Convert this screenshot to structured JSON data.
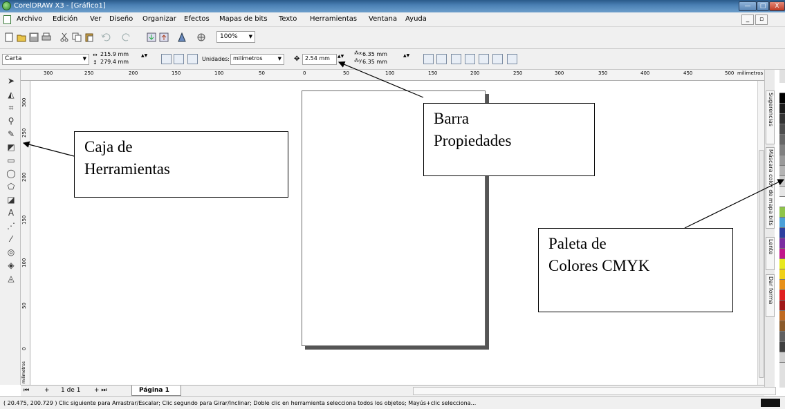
{
  "window": {
    "title": "CorelDRAW X3 - [Gráfico1]",
    "min_label": "—",
    "max_label": "□",
    "close_label": "X"
  },
  "menu": {
    "items": [
      "Archivo",
      "Edición",
      "Ver",
      "Diseño",
      "Organizar",
      "Efectos",
      "Mapas de bits",
      "Texto",
      "Herramientas",
      "Ventana",
      "Ayuda"
    ],
    "mdi_min": "_",
    "mdi_restore": "▫"
  },
  "toolbar": {
    "zoom": "100%"
  },
  "propbar": {
    "paper_size": "Carta",
    "width": "215.9 mm",
    "height": "279.4 mm",
    "units_label": "Unidades:",
    "units_value": "milímetros",
    "nudge": "2.54 mm",
    "dup_x": "6.35 mm",
    "dup_y": "6.35 mm"
  },
  "ruler": {
    "h_labels": [
      "300",
      "250",
      "200",
      "150",
      "100",
      "50",
      "0",
      "50",
      "100",
      "150",
      "200",
      "250",
      "300",
      "350",
      "400",
      "450",
      "500",
      "milímetros"
    ],
    "v_labels": [
      "300",
      "250",
      "200",
      "150",
      "100",
      "50",
      "0"
    ],
    "v_unit": "milímetros"
  },
  "navigation": {
    "page_count": "1 de 1",
    "page_tab": "Página 1"
  },
  "statusbar": {
    "text": "( 20.475, 200.729 )   Clic siguiente para Arrastrar/Escalar; Clic segundo para Girar/Inclinar; Doble clic en herramienta selecciona todos los objetos; Mayús+clic selecciona..."
  },
  "dockers": [
    "Sugerencias",
    "Máscara color de mapa bits",
    "Lente",
    "Dar forma"
  ],
  "palette_colors": [
    "#ffffff",
    "#000000",
    "#1a1a1a",
    "#333333",
    "#4d4d4d",
    "#666666",
    "#808080",
    "#999999",
    "#b3b3b3",
    "#cccccc",
    "#e6e6e6",
    "#ffffff",
    "#8fc44a",
    "#4aa0d8",
    "#2d3fa0",
    "#7a2da0",
    "#c0168a",
    "#e8e81e",
    "#f0d018",
    "#e89018",
    "#e02020",
    "#a01818",
    "#c06a20",
    "#8a5a2a",
    "#606060",
    "#404040",
    "#d0d0d0"
  ],
  "callouts": {
    "toolbox": [
      "Caja de",
      "Herramientas"
    ],
    "propbar": [
      "Barra",
      "Propiedades"
    ],
    "palette": [
      "Paleta de",
      "Colores CMYK"
    ]
  }
}
